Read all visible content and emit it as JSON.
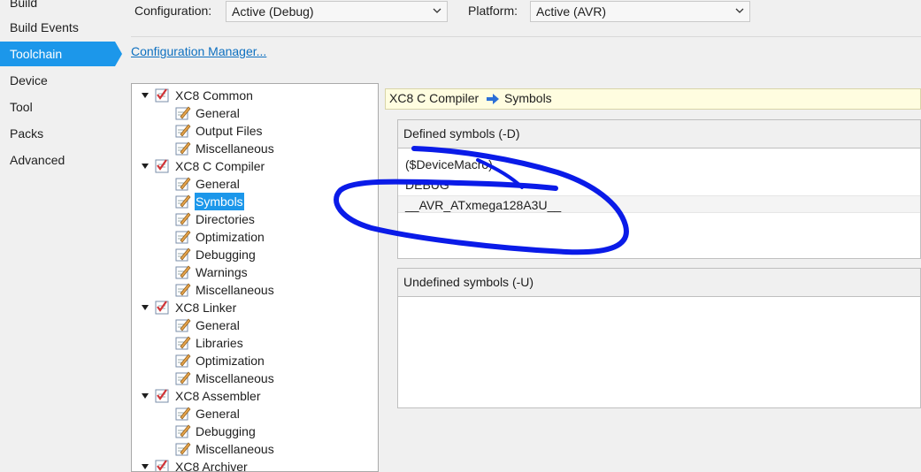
{
  "nav": {
    "items": [
      "Build",
      "Build Events",
      "Toolchain",
      "Device",
      "Tool",
      "Packs",
      "Advanced"
    ],
    "selected": "Toolchain"
  },
  "config": {
    "configuration_label": "Configuration:",
    "configuration_value": "Active (Debug)",
    "platform_label": "Platform:",
    "platform_value": "Active (AVR)",
    "manager_link": "Configuration Manager..."
  },
  "tree": {
    "groups": [
      {
        "label": "XC8 Common",
        "children": [
          "General",
          "Output Files",
          "Miscellaneous"
        ]
      },
      {
        "label": "XC8 C Compiler",
        "children": [
          "General",
          "Symbols",
          "Directories",
          "Optimization",
          "Debugging",
          "Warnings",
          "Miscellaneous"
        ]
      },
      {
        "label": "XC8 Linker",
        "children": [
          "General",
          "Libraries",
          "Optimization",
          "Miscellaneous"
        ]
      },
      {
        "label": "XC8 Assembler",
        "children": [
          "General",
          "Debugging",
          "Miscellaneous"
        ]
      },
      {
        "label": "XC8 Archiver",
        "children": []
      }
    ],
    "selected": "Symbols"
  },
  "breadcrumb": {
    "parent": "XC8 C Compiler",
    "current": "Symbols"
  },
  "defined": {
    "title": "Defined symbols (-D)",
    "items": [
      "($DeviceMacro)",
      "DEBUG",
      "__AVR_ATxmega128A3U__"
    ]
  },
  "undefined": {
    "title": "Undefined symbols (-U)",
    "items": []
  },
  "colors": {
    "selection": "#1c97ea",
    "link": "#0e70c0",
    "annotation": "#0a1be8"
  }
}
